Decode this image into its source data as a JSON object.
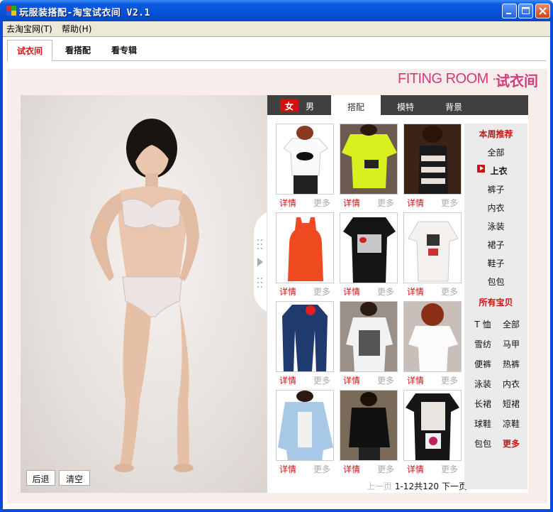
{
  "window": {
    "title": "玩服装搭配-淘宝试衣间 V2.1"
  },
  "menu": {
    "items": [
      {
        "label": "去淘宝网(T)"
      },
      {
        "label": "帮助(H)"
      }
    ]
  },
  "top_tabs": [
    {
      "label": "试衣间"
    },
    {
      "label": "看搭配"
    },
    {
      "label": "看专辑"
    }
  ],
  "banner": {
    "en": "FITING ROOM · ",
    "cn": "试衣间"
  },
  "model_controls": {
    "back": "后退",
    "clear": "清空"
  },
  "catalog": {
    "gender": {
      "female": "女",
      "male": "男"
    },
    "tabs": [
      {
        "label": "搭配"
      },
      {
        "label": "模特"
      },
      {
        "label": "背景"
      }
    ],
    "products": [
      {
        "detail": "详情",
        "more": "更多"
      },
      {
        "detail": "详情",
        "more": "更多"
      },
      {
        "detail": "详情",
        "more": "更多"
      },
      {
        "detail": "详情",
        "more": "更多"
      },
      {
        "detail": "详情",
        "more": "更多"
      },
      {
        "detail": "详情",
        "more": "更多"
      },
      {
        "detail": "详情",
        "more": "更多"
      },
      {
        "detail": "详情",
        "more": "更多"
      },
      {
        "detail": "详情",
        "more": "更多"
      },
      {
        "detail": "详情",
        "more": "更多"
      },
      {
        "detail": "详情",
        "more": "更多"
      },
      {
        "detail": "详情",
        "more": "更多"
      }
    ],
    "pager": {
      "prev": "上一页",
      "range": "1-12共120",
      "next": "下一页"
    }
  },
  "sidebar": {
    "weekly_title": "本周推荐",
    "weekly_items": [
      "全部",
      "上衣",
      "裤子",
      "内衣",
      "泳装",
      "裙子",
      "鞋子",
      "包包"
    ],
    "active_item": "上衣",
    "all_title": "所有宝贝",
    "all_items": [
      "T 恤",
      "全部",
      "雪纺",
      "马甲",
      "便裤",
      "热裤",
      "泳装",
      "内衣",
      "长裙",
      "短裙",
      "球鞋",
      "凉鞋",
      "包包",
      "更多"
    ]
  },
  "colors": {
    "accent": "#c81414",
    "banner": "#d33a7a",
    "titlebar": "#0552d8"
  }
}
